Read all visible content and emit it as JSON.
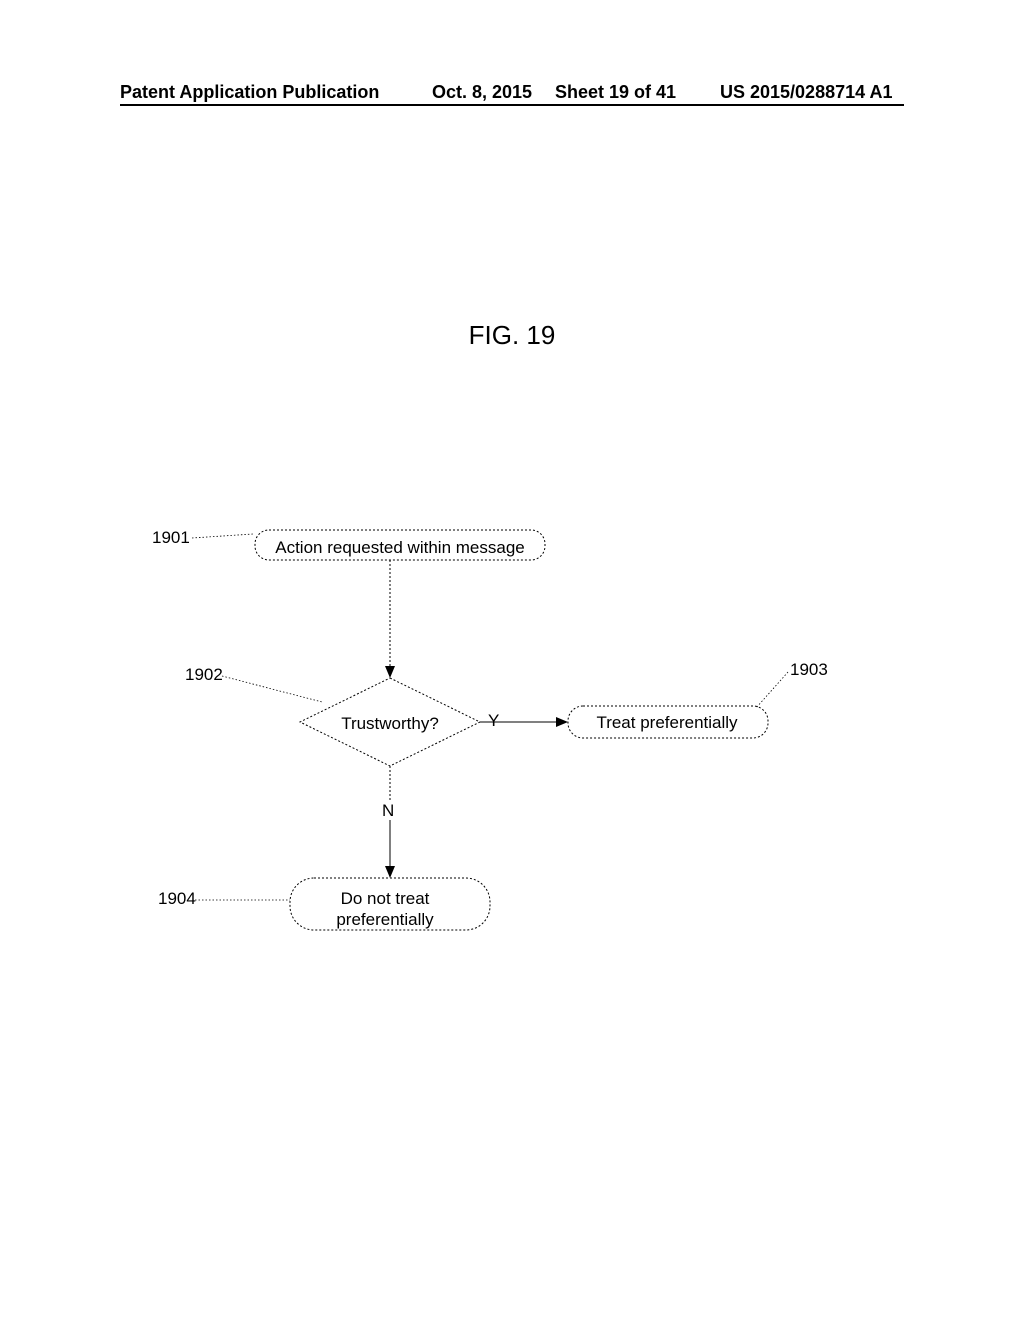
{
  "header": {
    "left": "Patent Application Publication",
    "date": "Oct. 8, 2015",
    "sheet": "Sheet 19 of 41",
    "pubno": "US 2015/0288714 A1"
  },
  "figure": {
    "title": "FIG. 19"
  },
  "refs": {
    "r1901": "1901",
    "r1902": "1902",
    "r1903": "1903",
    "r1904": "1904"
  },
  "nodes": {
    "start": "Action requested within message",
    "decision": "Trustworthy?",
    "yes": "Y",
    "no": "N",
    "pref": "Treat preferentially",
    "notpref": "Do not treat\npreferentially"
  }
}
